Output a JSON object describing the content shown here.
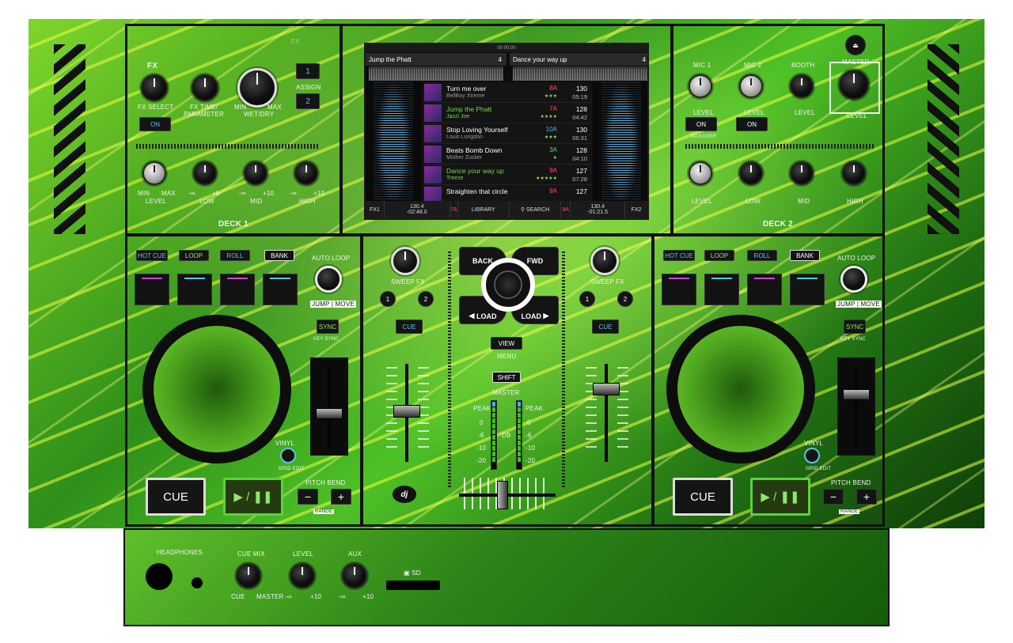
{
  "fx": {
    "title": "FX",
    "badge": "FX",
    "fx_select": "FX SELECT",
    "fx_time": "FX TIME/",
    "parameter": "PARAMETER",
    "min": "MIN",
    "max": "MAX",
    "wet_dry": "WET/DRY",
    "assign_1": "1",
    "assign": "ASSIGN",
    "assign_2": "2",
    "on": "ON"
  },
  "deck1": {
    "name": "DECK 1",
    "eq_labels": [
      "LEVEL",
      "LOW",
      "MID",
      "HIGH"
    ],
    "min": "MIN",
    "max": "MAX",
    "neg_inf": "-∞",
    "plus6": "+6",
    "plus10": "+10",
    "pad_modes": [
      "HOT CUE",
      "LOOP",
      "ROLL",
      "BANK"
    ],
    "auto_loop": "AUTO LOOP",
    "jump_move": "JUMP | MOVE",
    "sync": "SYNC",
    "key_sync": "KEY SYNC",
    "vinyl": "VINYL",
    "grid_edit": "GRID EDIT",
    "cue": "CUE",
    "play": "▶ / ❚❚",
    "pitch_bend": "PITCH BEND",
    "minus": "−",
    "plus": "+",
    "range": "RANGE",
    "pad_colors": [
      "#c64bd4",
      "#58c7e0",
      "#c64bd4",
      "#58c7e0"
    ]
  },
  "deck2": {
    "name": "DECK 2",
    "mic1": "MIC 1",
    "mic2": "MIC 2",
    "booth": "BOOTH",
    "master": "MASTER",
    "level": "LEVEL",
    "talkover": "TALKOVER",
    "on": "ON",
    "eq_labels": [
      "LEVEL",
      "LOW",
      "MID",
      "HIGH"
    ],
    "pad_modes": [
      "HOT CUE",
      "LOOP",
      "ROLL",
      "BANK"
    ],
    "auto_loop": "AUTO LOOP",
    "jump_move": "JUMP | MOVE",
    "sync": "SYNC",
    "key_sync": "KEY SYNC",
    "vinyl": "VINYL",
    "grid_edit": "GRID EDIT",
    "cue": "CUE",
    "play": "▶ / ❚❚",
    "pitch_bend": "PITCH BEND",
    "minus": "−",
    "plus": "+",
    "range": "RANGE",
    "pad_colors": [
      "#c64bd4",
      "#58c7e0",
      "#c64bd4",
      "#58c7e0"
    ]
  },
  "mixer": {
    "sweep_fx": "SWEEP FX",
    "fx1": "1",
    "fx2": "2",
    "cue": "CUE",
    "back": "BACK",
    "fwd": "FWD",
    "load": "LOAD",
    "view": "VIEW",
    "menu": "MENU",
    "shift": "SHIFT",
    "master": "MASTER",
    "db": "dB",
    "meter_labels": [
      "PEAK",
      "0",
      "-6",
      "-10",
      "-20"
    ],
    "logo": "dj"
  },
  "screen": {
    "status_time": "00:00:00",
    "deck1_track": "Jump the Phatt",
    "deck1_loop": "4",
    "deck2_track": "Dance your way up",
    "deck2_loop": "4",
    "tracks": [
      {
        "title": "Turn me over",
        "artist": "BellBoy Xtreme",
        "key": "8A",
        "key_color": "#ff4b6b",
        "bpm": "130",
        "dur": "05:19",
        "rating": "★★★",
        "green": false
      },
      {
        "title": "Jump the Phatt",
        "artist": "Jazzi Joe",
        "key": "7A",
        "key_color": "#ff4b6b",
        "bpm": "128",
        "dur": "04:42",
        "rating": "★★★★",
        "green": true
      },
      {
        "title": "Stop Loving Yourself",
        "artist": "Louis Longdon",
        "key": "10A",
        "key_color": "#4bb8ff",
        "bpm": "130",
        "dur": "06:31",
        "rating": "★★★",
        "green": false
      },
      {
        "title": "Beats Bomb Down",
        "artist": "Mother Zucker",
        "key": "3A",
        "key_color": "#4be06b",
        "bpm": "128",
        "dur": "04:10",
        "rating": "★",
        "green": false
      },
      {
        "title": "Dance your way up",
        "artist": "Treeze",
        "key": "9A",
        "key_color": "#ff4b6b",
        "bpm": "127",
        "dur": "07:28",
        "rating": "★★★★★",
        "green": true
      },
      {
        "title": "Straighten that circle",
        "artist": "",
        "key": "9A",
        "key_color": "#ff4b6b",
        "bpm": "127",
        "dur": "",
        "rating": "",
        "green": false
      }
    ],
    "fx1": "FX1",
    "fx2": "FX2",
    "bpm1": "130",
    "bpm1_dec": "4",
    "time1": "-02:48",
    "time1_dec": "0",
    "key1": "7A",
    "library": "LIBRARY",
    "search": "SEARCH",
    "bpm2": "130",
    "bpm2_dec": "4",
    "time2": "-01:21",
    "time2_dec": "5",
    "key2": "9A"
  },
  "front": {
    "headphones": "HEADPHONES",
    "cue_mix": "CUE MIX",
    "cue": "CUE",
    "master": "MASTER",
    "level": "LEVEL",
    "aux": "AUX",
    "neg_inf": "-∞",
    "plus10": "+10",
    "sd": "SD"
  }
}
